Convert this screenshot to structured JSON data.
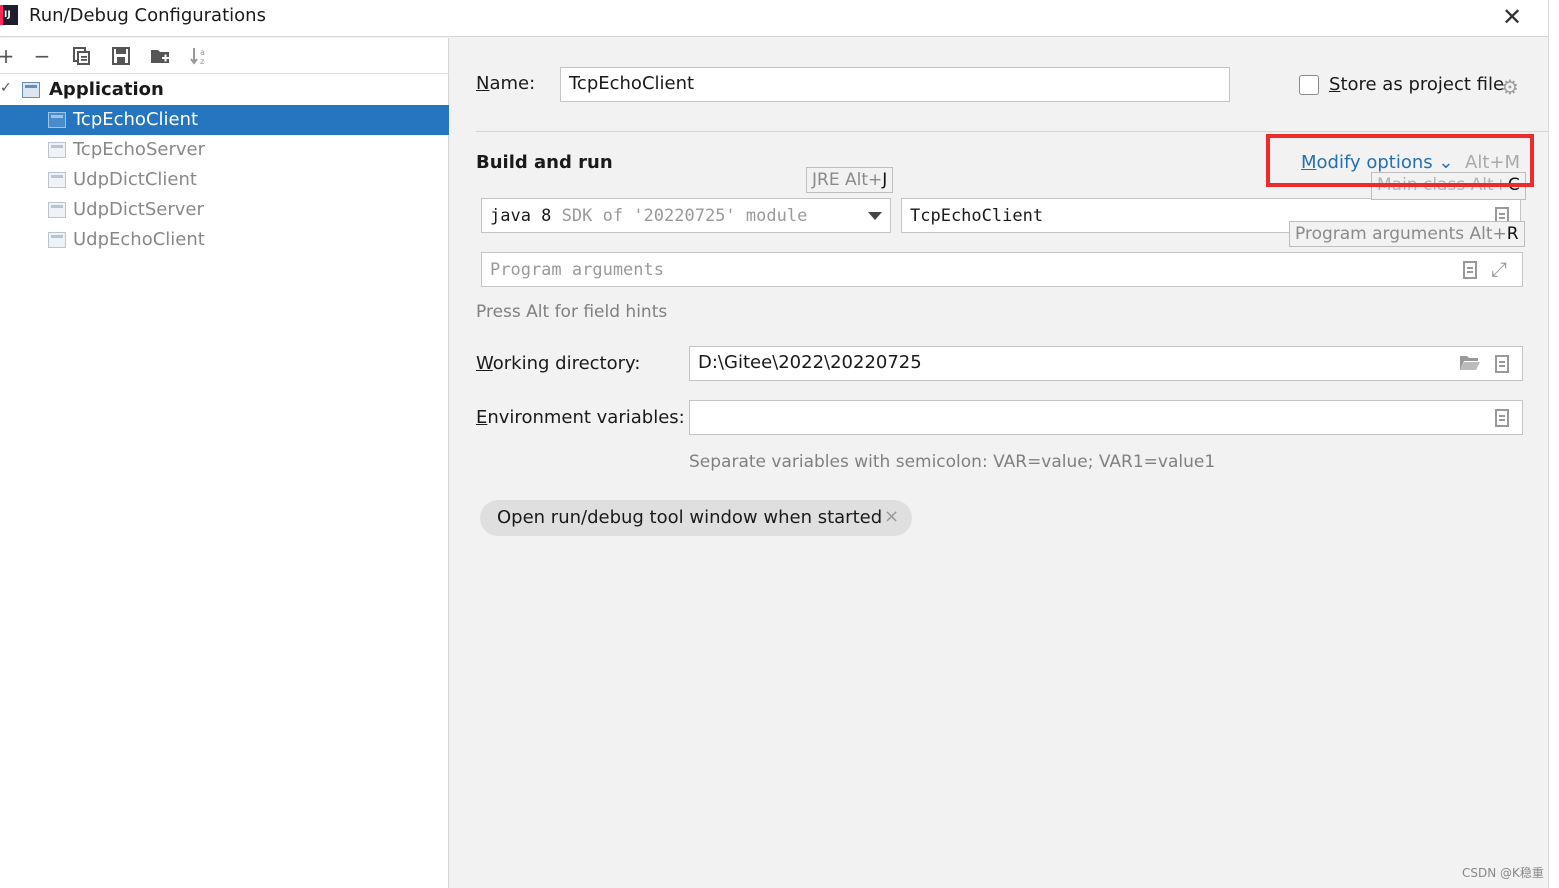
{
  "window": {
    "logo_text": "IJ",
    "title": "Run/Debug Configurations"
  },
  "toolbar": {
    "add": "+",
    "remove": "−"
  },
  "tree": {
    "group": "Application",
    "items": [
      "TcpEchoClient",
      "TcpEchoServer",
      "UdpDictClient",
      "UdpDictServer",
      "UdpEchoClient"
    ],
    "selected_index": 0
  },
  "form": {
    "name_mnemonic": "N",
    "name_rest": "ame:",
    "name_value": "TcpEchoClient",
    "store_mnemonic": "S",
    "store_rest": "tore as project file",
    "build_and_run": "Build and run",
    "modify_mnemonic": "M",
    "modify_rest": "odify options",
    "modify_shortcut": "Alt+M",
    "jre_hint_text": "JRE Alt+",
    "jre_hint_key": "J",
    "jre_value_main": "java 8",
    "jre_value_sub": "SDK of '20220725' module",
    "main_class_value": "TcpEchoClient",
    "main_class_hint_text": "Main class Alt+",
    "main_class_hint_key": "C",
    "program_args_placeholder": "Program arguments",
    "program_args_hint_text": "Program arguments Alt+",
    "program_args_hint_key": "R",
    "press_alt_hint": "Press Alt for field hints",
    "workdir_mnemonic": "W",
    "workdir_rest": "orking directory:",
    "workdir_value": "D:\\Gitee\\2022\\20220725",
    "env_mnemonic": "E",
    "env_rest": "nvironment variables:",
    "env_value": "",
    "env_help": "Separate variables with semicolon: VAR=value; VAR1=value1",
    "chip_label": "Open run/debug tool window when started",
    "chip_close": "×"
  },
  "watermark": "CSDN @K稳重",
  "colors": {
    "selection": "#2675bf",
    "link": "#2470b3",
    "highlight_box": "#ee2b2b"
  }
}
